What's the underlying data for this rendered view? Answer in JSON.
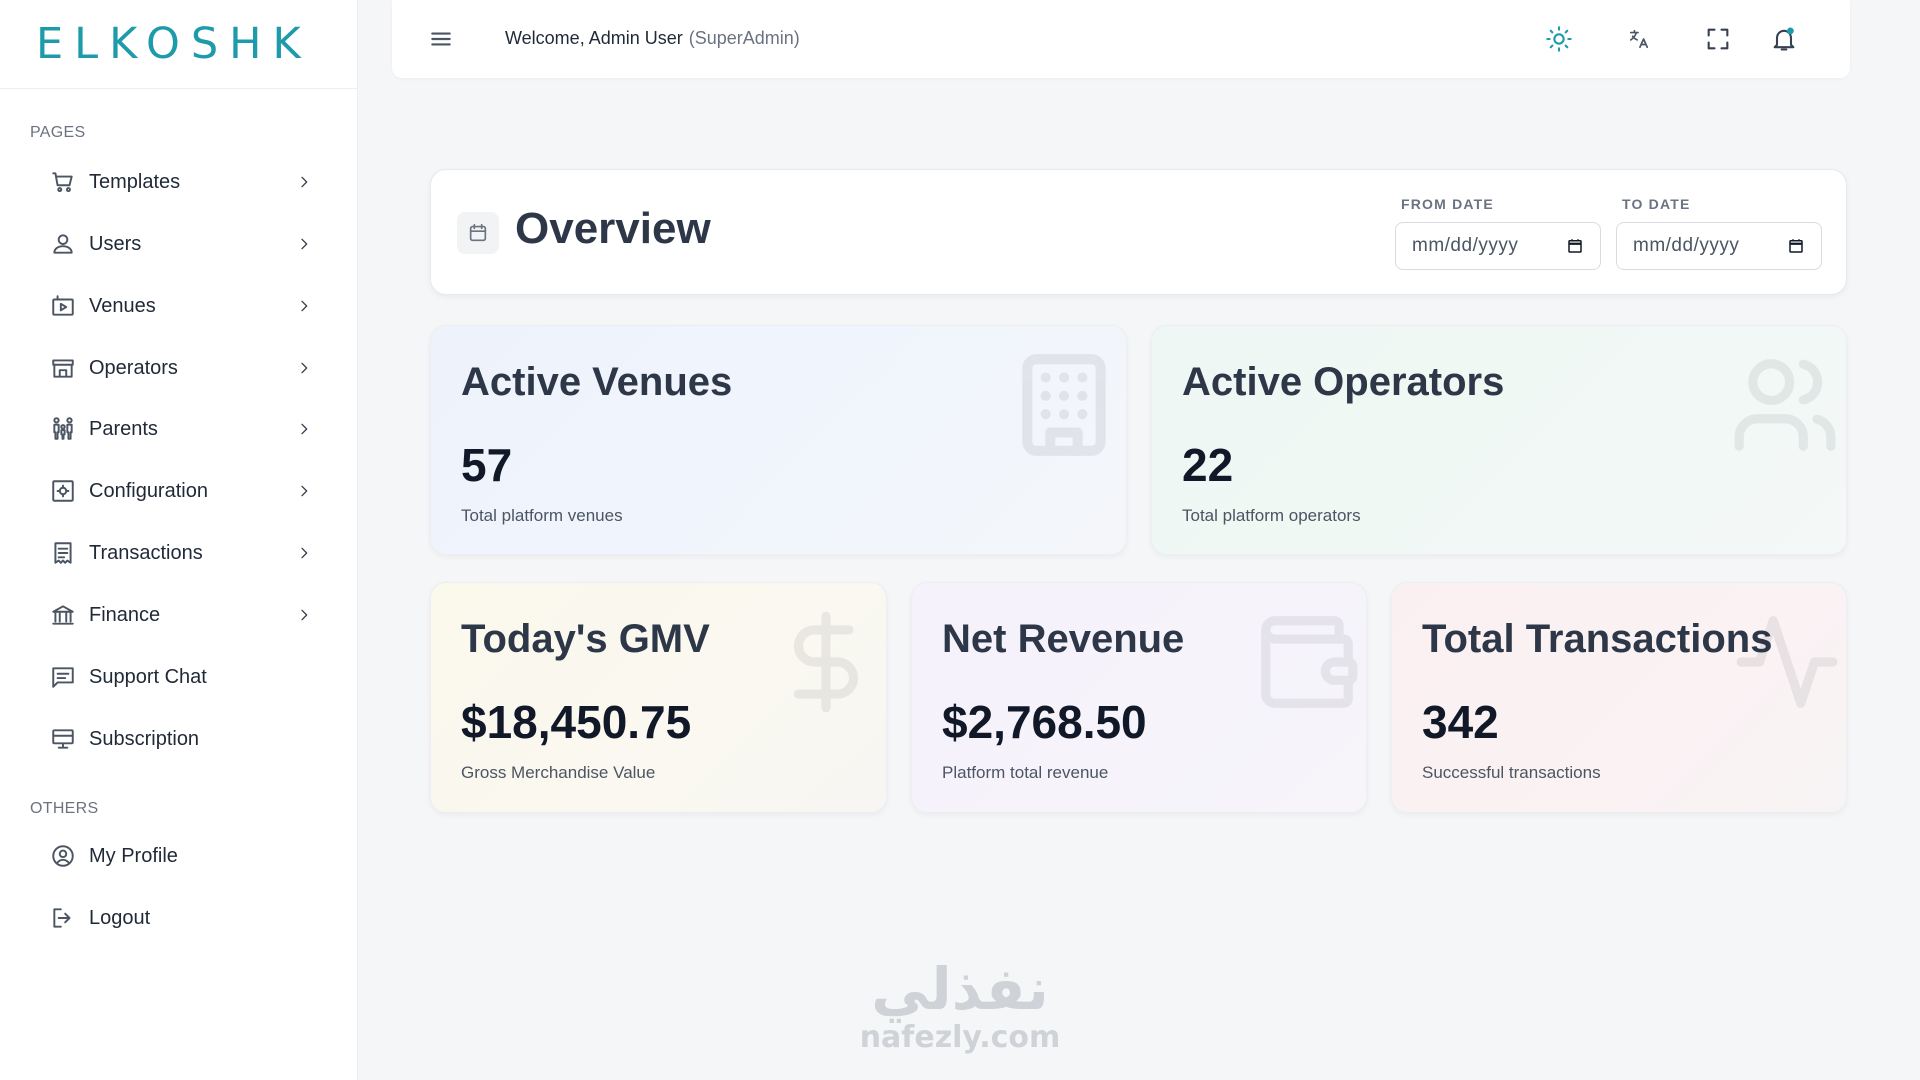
{
  "brand": {
    "logo_text": "ELKOSHK",
    "accent_color": "#1e9bab"
  },
  "sidebar": {
    "pages_label": "PAGES",
    "others_label": "OTHERS",
    "items": [
      {
        "label": "Templates",
        "icon": "cart-icon",
        "has_chevron": true
      },
      {
        "label": "Users",
        "icon": "user-icon",
        "has_chevron": true
      },
      {
        "label": "Venues",
        "icon": "venue-icon",
        "has_chevron": true
      },
      {
        "label": "Operators",
        "icon": "store-icon",
        "has_chevron": true
      },
      {
        "label": "Parents",
        "icon": "family-icon",
        "has_chevron": true
      },
      {
        "label": "Configuration",
        "icon": "config-icon",
        "has_chevron": true
      },
      {
        "label": "Transactions",
        "icon": "receipt-icon",
        "has_chevron": true
      },
      {
        "label": "Finance",
        "icon": "bank-icon",
        "has_chevron": true
      },
      {
        "label": "Support Chat",
        "icon": "chat-icon",
        "has_chevron": false
      },
      {
        "label": "Subscription",
        "icon": "subscription-icon",
        "has_chevron": false
      }
    ],
    "others": [
      {
        "label": "My Profile",
        "icon": "profile-icon"
      },
      {
        "label": "Logout",
        "icon": "logout-icon"
      }
    ]
  },
  "header": {
    "welcome": "Welcome, Admin User",
    "role": "(SuperAdmin)",
    "icons": [
      "sun-icon",
      "translate-icon",
      "fullscreen-icon",
      "bell-icon"
    ]
  },
  "overview": {
    "title": "Overview",
    "from_label": "FROM DATE",
    "to_label": "TO DATE",
    "from_placeholder": "mm/dd/yyyy",
    "to_placeholder": "mm/dd/yyyy"
  },
  "stats": {
    "active_venues": {
      "title": "Active Venues",
      "value": "57",
      "sub": "Total platform venues",
      "icon": "building-icon"
    },
    "active_operators": {
      "title": "Active Operators",
      "value": "22",
      "sub": "Total platform operators",
      "icon": "users-icon"
    },
    "gmv": {
      "title": "Today's GMV",
      "value": "$18,450.75",
      "sub": "Gross Merchandise Value",
      "icon": "dollar-icon"
    },
    "net_revenue": {
      "title": "Net Revenue",
      "value": "$2,768.50",
      "sub": "Platform total revenue",
      "icon": "wallet-icon"
    },
    "transactions": {
      "title": "Total Transactions",
      "value": "342",
      "sub": "Successful transactions",
      "icon": "activity-icon"
    }
  },
  "watermark": {
    "arabic": "نفذلي",
    "latin": "nafezly.com"
  }
}
